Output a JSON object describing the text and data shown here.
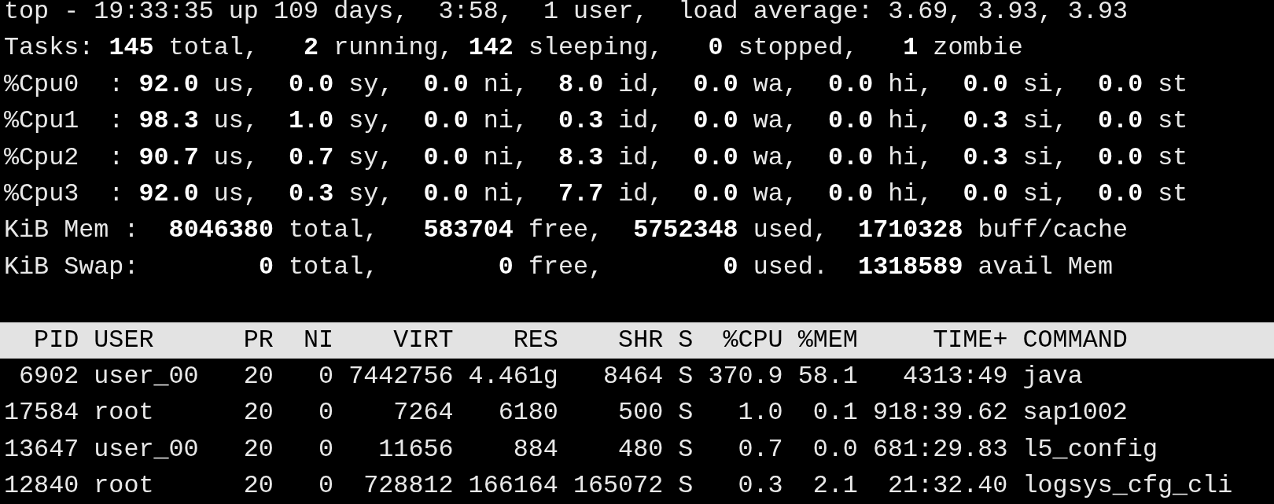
{
  "summary_lines": [
    "top - 19:33:35 up 109 days,  3:58,  1 user,  load average: 3.69, 3.93, 3.93",
    "Tasks: **145** total,   **2** running, **142** sleeping,   **0** stopped,   **1** zombie",
    "%Cpu0  : **92.0** us,  **0.0** sy,  **0.0** ni,  **8.0** id,  **0.0** wa,  **0.0** hi,  **0.0** si,  **0.0** st",
    "%Cpu1  : **98.3** us,  **1.0** sy,  **0.0** ni,  **0.3** id,  **0.0** wa,  **0.0** hi,  **0.3** si,  **0.0** st",
    "%Cpu2  : **90.7** us,  **0.7** sy,  **0.0** ni,  **8.3** id,  **0.0** wa,  **0.0** hi,  **0.3** si,  **0.0** st",
    "%Cpu3  : **92.0** us,  **0.3** sy,  **0.0** ni,  **7.7** id,  **0.0** wa,  **0.0** hi,  **0.0** si,  **0.0** st",
    "KiB Mem :  **8046380** total,   **583704** free,  **5752348** used,  **1710328** buff/cache",
    "KiB Swap:        **0** total,        **0** free,        **0** used.  **1318589** avail Mem"
  ],
  "process_table": {
    "columns": [
      "PID",
      "USER",
      "PR",
      "NI",
      "VIRT",
      "RES",
      "SHR",
      "S",
      "%CPU",
      "%MEM",
      "TIME+",
      "COMMAND"
    ],
    "rows": [
      [
        "6902",
        "user_00",
        "20",
        "0",
        "7442756",
        "4.461g",
        "8464",
        "S",
        "370.9",
        "58.1",
        "4313:49",
        "java"
      ],
      [
        "17584",
        "root",
        "20",
        "0",
        "7264",
        "6180",
        "500",
        "S",
        "1.0",
        "0.1",
        "918:39.62",
        "sap1002"
      ],
      [
        "13647",
        "user_00",
        "20",
        "0",
        "11656",
        "884",
        "480",
        "S",
        "0.7",
        "0.0",
        "681:29.83",
        "l5_config"
      ],
      [
        "12840",
        "root",
        "20",
        "0",
        "728812",
        "166164",
        "165072",
        "S",
        "0.3",
        "2.1",
        "21:32.40",
        "logsys_cfg_cli"
      ]
    ]
  }
}
